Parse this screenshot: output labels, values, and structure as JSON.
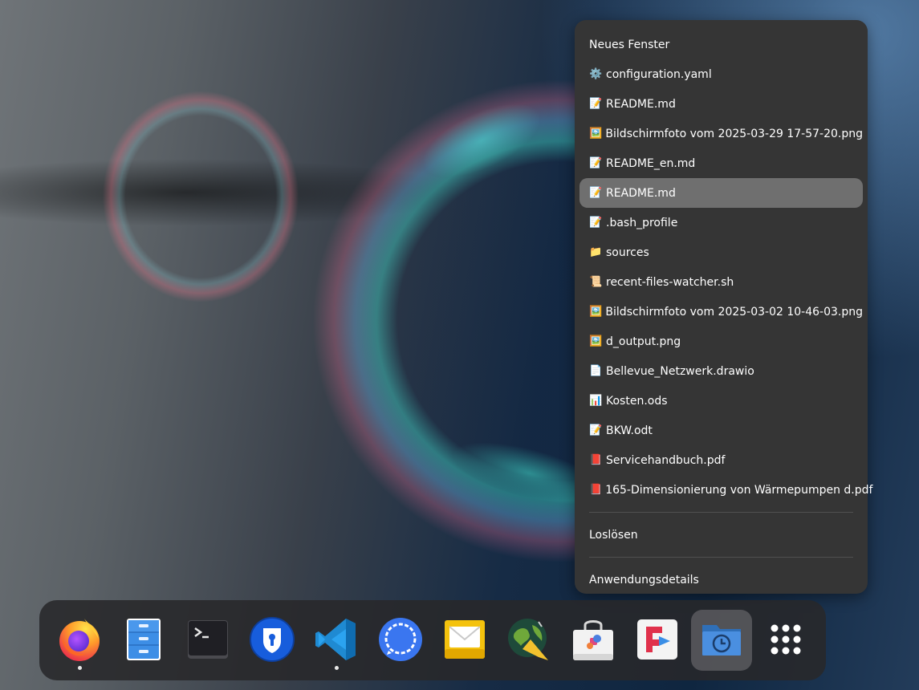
{
  "menu": {
    "new_window": "Neues Fenster",
    "recent_files": [
      {
        "icon": "gear-icon",
        "glyph": "⚙️",
        "name": "configuration.yaml"
      },
      {
        "icon": "memo-icon",
        "glyph": "📝",
        "name": "README.md"
      },
      {
        "icon": "picture-icon",
        "glyph": "🖼️",
        "name": "Bildschirmfoto vom 2025-03-29 17-57-20.png"
      },
      {
        "icon": "memo-icon",
        "glyph": "📝",
        "name": "README_en.md"
      },
      {
        "icon": "memo-icon",
        "glyph": "📝",
        "name": "README.md"
      },
      {
        "icon": "memo-icon",
        "glyph": "📝",
        "name": ".bash_profile"
      },
      {
        "icon": "folder-icon",
        "glyph": "📁",
        "name": "sources"
      },
      {
        "icon": "scroll-icon",
        "glyph": "📜",
        "name": "recent-files-watcher.sh"
      },
      {
        "icon": "picture-icon",
        "glyph": "🖼️",
        "name": "Bildschirmfoto vom 2025-03-02 10-46-03.png"
      },
      {
        "icon": "picture-icon",
        "glyph": "🖼️",
        "name": "d_output.png"
      },
      {
        "icon": "document-icon",
        "glyph": "📄",
        "name": "Bellevue_Netzwerk.drawio"
      },
      {
        "icon": "bar-chart-icon",
        "glyph": "📊",
        "name": "Kosten.ods"
      },
      {
        "icon": "memo-icon",
        "glyph": "📝",
        "name": "BKW.odt"
      },
      {
        "icon": "red-book-icon",
        "glyph": "📕",
        "name": "Servicehandbuch.pdf"
      },
      {
        "icon": "red-book-icon",
        "glyph": "📕",
        "name": "165-Dimensionierung von Wärmepumpen d.pdf"
      }
    ],
    "detach": "Loslösen",
    "app_details": "Anwendungsdetails"
  },
  "dock": {
    "apps": [
      {
        "name": "Firefox",
        "icon": "firefox-icon",
        "running": true
      },
      {
        "name": "Files",
        "icon": "file-cabinet-icon",
        "running": false
      },
      {
        "name": "Terminal",
        "icon": "terminal-icon",
        "running": false
      },
      {
        "name": "Bitwarden",
        "icon": "keyhole-shield-icon",
        "running": false
      },
      {
        "name": "Visual Studio Code",
        "icon": "vscode-icon",
        "running": true
      },
      {
        "name": "Signal",
        "icon": "speech-bubble-icon",
        "running": false
      },
      {
        "name": "Mail",
        "icon": "envelope-icon",
        "running": false
      },
      {
        "name": "JOSM",
        "icon": "globe-icon",
        "running": false
      },
      {
        "name": "Software",
        "icon": "shopping-bag-icon",
        "running": false
      },
      {
        "name": "Flathub",
        "icon": "flathub-icon",
        "running": false
      },
      {
        "name": "Recent Files",
        "icon": "recent-folder-icon",
        "running": false,
        "selected": true
      },
      {
        "name": "Show Apps",
        "icon": "app-grid-icon",
        "running": false
      }
    ]
  }
}
